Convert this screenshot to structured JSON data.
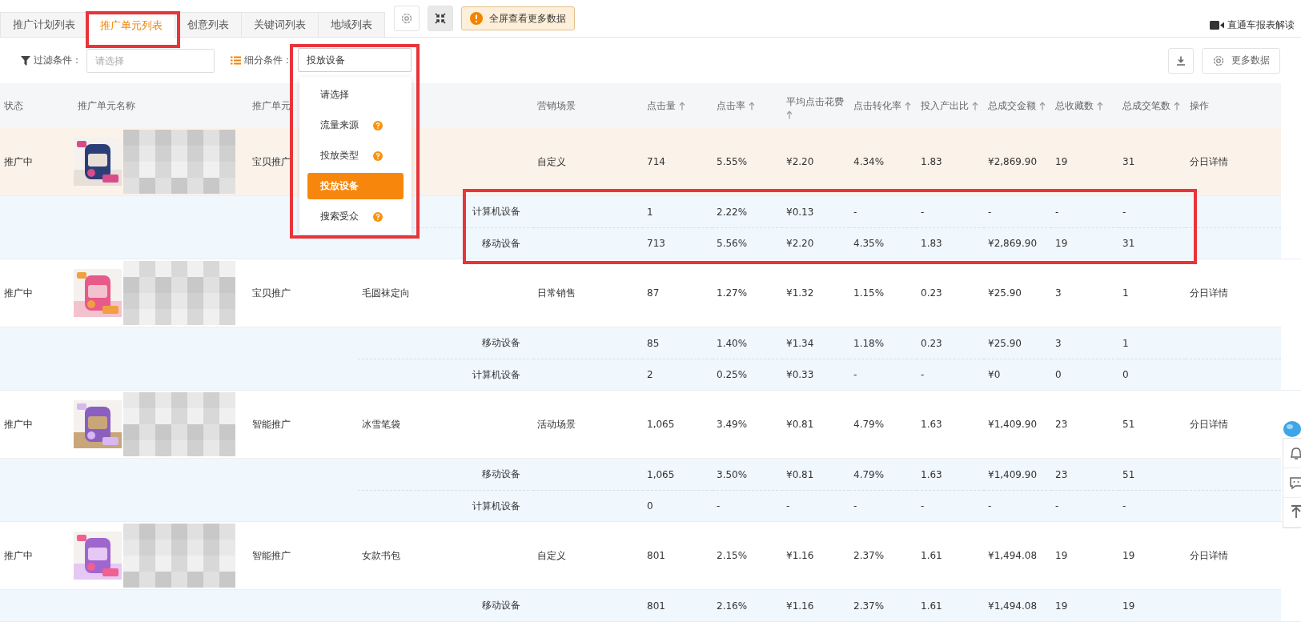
{
  "tabs": [
    {
      "label": "推广计划列表",
      "selected": false
    },
    {
      "label": "推广单元列表",
      "selected": true
    },
    {
      "label": "创意列表",
      "selected": false
    },
    {
      "label": "关键词列表",
      "selected": false
    },
    {
      "label": "地域列表",
      "selected": false
    }
  ],
  "fullscreen_tip": "全屏查看更多数据",
  "help_link": "直通车报表解读",
  "filter": {
    "label": "过滤条件：",
    "placeholder": "请选择"
  },
  "segment": {
    "label": "细分条件：",
    "value": "投放设备",
    "options": [
      {
        "label": "请选择",
        "help": false,
        "selected": false
      },
      {
        "label": "流量来源",
        "help": true,
        "selected": false
      },
      {
        "label": "投放类型",
        "help": true,
        "selected": false
      },
      {
        "label": "投放设备",
        "help": false,
        "selected": true
      },
      {
        "label": "搜索受众",
        "help": true,
        "selected": false
      }
    ]
  },
  "more_data": "更多数据",
  "table": {
    "columns": [
      {
        "label": "状态",
        "sortable": false
      },
      {
        "label": "推广单元名称",
        "sortable": false
      },
      {
        "label": "推广单元",
        "sortable": false
      },
      {
        "label": "营销场景",
        "sortable": false
      },
      {
        "label": "点击量",
        "sortable": true
      },
      {
        "label": "点击率",
        "sortable": true
      },
      {
        "label": "平均点击花费",
        "sortable": true
      },
      {
        "label": "点击转化率",
        "sortable": true
      },
      {
        "label": "投入产出比",
        "sortable": true
      },
      {
        "label": "总成交金额",
        "sortable": true
      },
      {
        "label": "总收藏数",
        "sortable": true
      },
      {
        "label": "总成交笔数",
        "sortable": true
      },
      {
        "label": "操作",
        "sortable": false
      }
    ],
    "rows": [
      {
        "status": "推广中",
        "type": "宝贝推广",
        "unit": "",
        "scene": "自定义",
        "highlighted": true,
        "values": [
          "714",
          "5.55%",
          "¥2.20",
          "4.34%",
          "1.83",
          "¥2,869.90",
          "19",
          "31"
        ],
        "action": "分日详情",
        "children": [
          {
            "device": "计算机设备",
            "values": [
              "1",
              "2.22%",
              "¥0.13",
              "-",
              "-",
              "-",
              "-",
              "-"
            ]
          },
          {
            "device": "移动设备",
            "values": [
              "713",
              "5.56%",
              "¥2.20",
              "4.35%",
              "1.83",
              "¥2,869.90",
              "19",
              "31"
            ]
          }
        ]
      },
      {
        "status": "推广中",
        "type": "宝贝推广",
        "unit": "毛圆袜定向",
        "scene": "日常销售",
        "highlighted": false,
        "values": [
          "87",
          "1.27%",
          "¥1.32",
          "1.15%",
          "0.23",
          "¥25.90",
          "3",
          "1"
        ],
        "action": "分日详情",
        "children": [
          {
            "device": "移动设备",
            "values": [
              "85",
              "1.40%",
              "¥1.34",
              "1.18%",
              "0.23",
              "¥25.90",
              "3",
              "1"
            ]
          },
          {
            "device": "计算机设备",
            "values": [
              "2",
              "0.25%",
              "¥0.33",
              "-",
              "-",
              "¥0",
              "0",
              "0"
            ]
          }
        ]
      },
      {
        "status": "推广中",
        "type": "智能推广",
        "unit": "冰雪笔袋",
        "scene": "活动场景",
        "highlighted": false,
        "values": [
          "1,065",
          "3.49%",
          "¥0.81",
          "4.79%",
          "1.63",
          "¥1,409.90",
          "23",
          "51"
        ],
        "action": "分日详情",
        "children": [
          {
            "device": "移动设备",
            "values": [
              "1,065",
              "3.50%",
              "¥0.81",
              "4.79%",
              "1.63",
              "¥1,409.90",
              "23",
              "51"
            ]
          },
          {
            "device": "计算机设备",
            "values": [
              "0",
              "-",
              "-",
              "-",
              "-",
              "-",
              "-",
              "-"
            ]
          }
        ]
      },
      {
        "status": "推广中",
        "type": "智能推广",
        "unit": "女款书包",
        "scene": "自定义",
        "highlighted": false,
        "values": [
          "801",
          "2.15%",
          "¥1.16",
          "2.37%",
          "1.61",
          "¥1,494.08",
          "19",
          "19"
        ],
        "action": "分日详情",
        "children": [
          {
            "device": "移动设备",
            "values": [
              "801",
              "2.16%",
              "¥1.16",
              "2.37%",
              "1.61",
              "¥1,494.08",
              "19",
              "19"
            ]
          }
        ]
      }
    ]
  }
}
